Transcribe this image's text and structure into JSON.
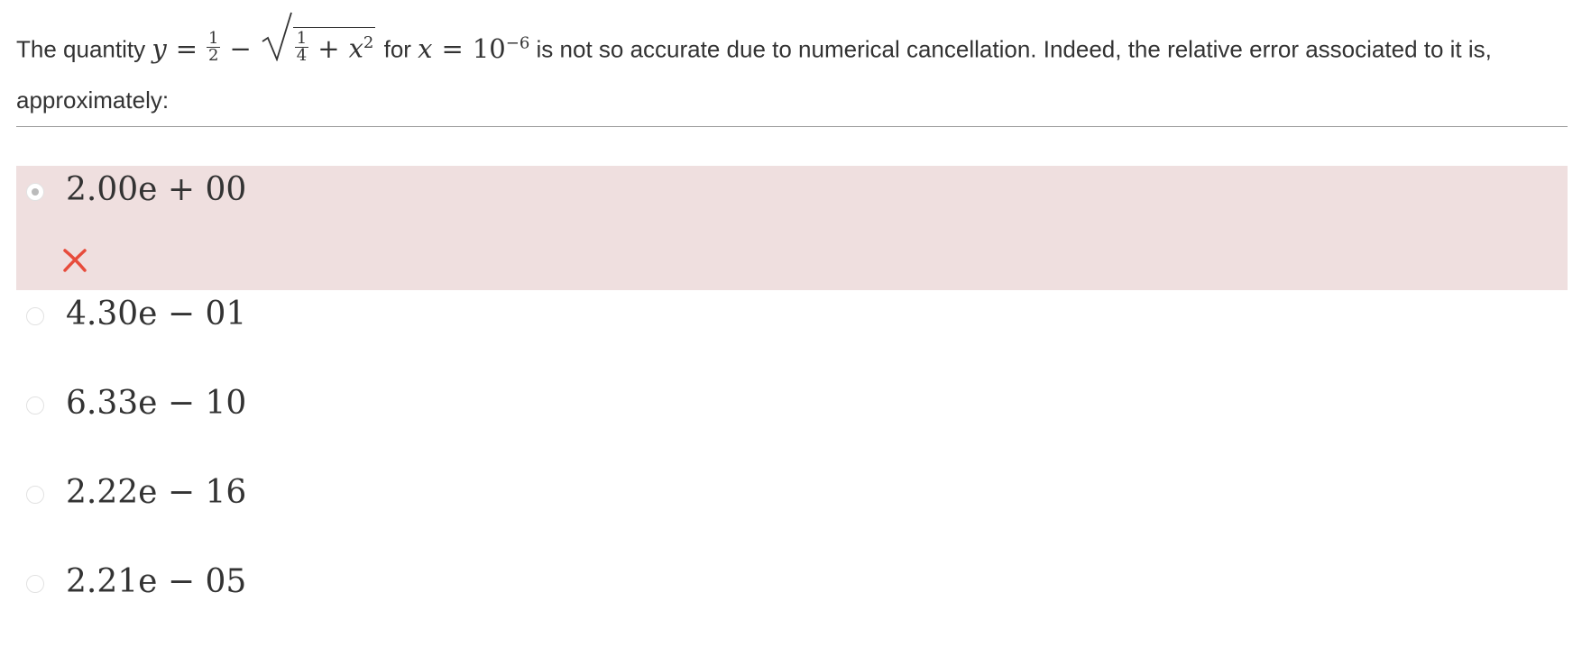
{
  "question": {
    "intro": "The quantity",
    "var_y": "y",
    "eq1": "=",
    "half_num": "1",
    "half_den": "2",
    "minus": "−",
    "quarter_num": "1",
    "quarter_den": "4",
    "plus": "+",
    "var_x2": "x",
    "sup2": "2",
    "for_text": "for",
    "var_x": "x",
    "eq2": "=",
    "base": "10",
    "exponent": "−6",
    "outro": "is not so accurate due to numerical cancellation. Indeed, the relative error associated to it is, approximately:"
  },
  "options": [
    {
      "label": "2.00e + 00",
      "selected": true,
      "status": "incorrect"
    },
    {
      "label": "4.30e − 01",
      "selected": false
    },
    {
      "label": "6.33e − 10",
      "selected": false
    },
    {
      "label": "2.22e − 16",
      "selected": false
    },
    {
      "label": "2.21e − 05",
      "selected": false
    }
  ],
  "colors": {
    "incorrect_background": "#efdfdf",
    "incorrect_mark": "#e74c3c"
  },
  "icons": {
    "incorrect": "cross-icon"
  }
}
